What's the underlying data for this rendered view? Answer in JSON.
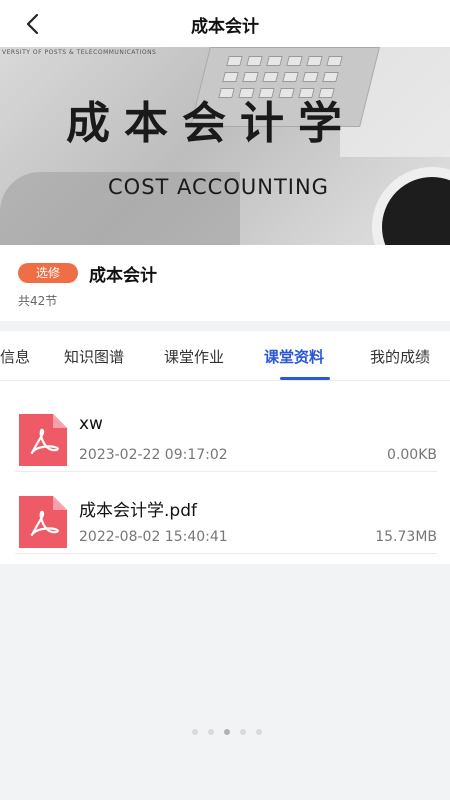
{
  "header": {
    "title": "成本会计",
    "back_icon": "chevron-left-icon"
  },
  "banner": {
    "small_text": "VERSITY OF POSTS & TELECOMMUNICATIONS",
    "title_cn": "成本会计学",
    "title_en": "COST   ACCOUNTING"
  },
  "course": {
    "badge": "选修",
    "name": "成本会计",
    "lessons": "共42节"
  },
  "tabs": [
    {
      "label": "信息"
    },
    {
      "label": "知识图谱"
    },
    {
      "label": "课堂作业"
    },
    {
      "label": "课堂资料"
    },
    {
      "label": "我的成绩"
    }
  ],
  "active_tab": 3,
  "files": [
    {
      "name": "xw",
      "date": "2023-02-22 09:17:02",
      "size": "0.00KB",
      "icon": "pdf-file-icon"
    },
    {
      "name": "成本会计学.pdf",
      "date": "2022-08-02 15:40:41",
      "size": "15.73MB",
      "icon": "pdf-file-icon"
    }
  ],
  "pagination": {
    "count": 5,
    "active": 2
  },
  "colors": {
    "accent": "#2b58d8",
    "badge": "#ee6f45",
    "pdf": "#ef5a67"
  }
}
